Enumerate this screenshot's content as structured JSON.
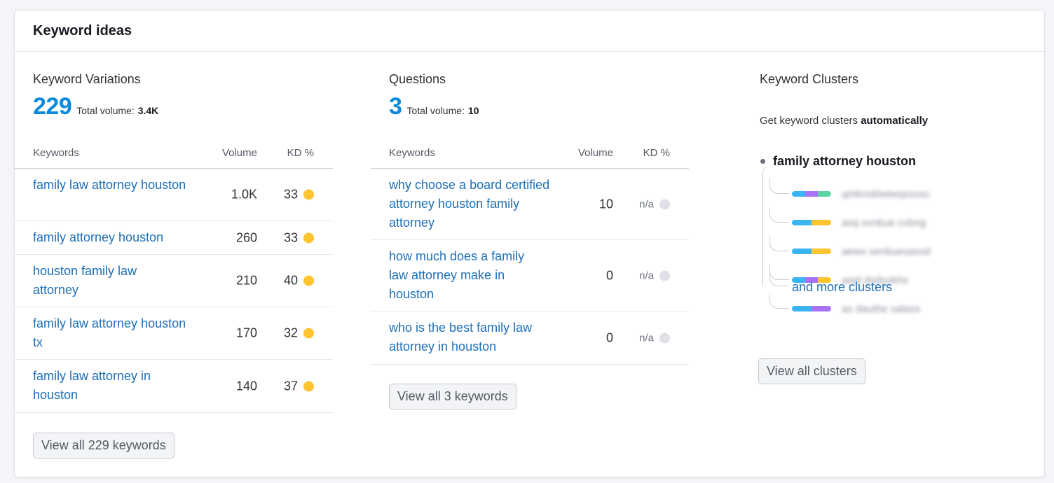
{
  "card": {
    "title": "Keyword ideas"
  },
  "variations": {
    "title": "Keyword Variations",
    "count": "229",
    "total_volume_label": "Total volume:",
    "total_volume": "3.4K",
    "headers": {
      "keyword": "Keywords",
      "volume": "Volume",
      "kd": "KD %"
    },
    "rows": [
      {
        "keyword": "family law attorney houston",
        "volume": "1.0K",
        "kd": "33",
        "kd_color": "#ffc531"
      },
      {
        "keyword": "family attorney houston",
        "volume": "260",
        "kd": "33",
        "kd_color": "#ffc531"
      },
      {
        "keyword": "houston family law attorney",
        "volume": "210",
        "kd": "40",
        "kd_color": "#ffc531"
      },
      {
        "keyword": "family law attorney houston tx",
        "volume": "170",
        "kd": "32",
        "kd_color": "#ffc531"
      },
      {
        "keyword": "family law attorney in houston",
        "volume": "140",
        "kd": "37",
        "kd_color": "#ffc531"
      }
    ],
    "button": "View all 229 keywords"
  },
  "questions": {
    "title": "Questions",
    "count": "3",
    "total_volume_label": "Total volume:",
    "total_volume": "10",
    "headers": {
      "keyword": "Keywords",
      "volume": "Volume",
      "kd": "KD %"
    },
    "rows": [
      {
        "keyword": "why choose a board certified attorney houston family attorney",
        "volume": "10",
        "kd": "n/a",
        "kd_color": "#dfe1e6"
      },
      {
        "keyword": "how much does a family law attorney make in houston",
        "volume": "0",
        "kd": "n/a",
        "kd_color": "#dfe1e6"
      },
      {
        "keyword": "who is the best family law attorney in houston",
        "volume": "0",
        "kd": "n/a",
        "kd_color": "#dfe1e6"
      }
    ],
    "button": "View all 3 keywords"
  },
  "clusters": {
    "title": "Keyword Clusters",
    "description_prefix": "Get keyword clusters",
    "description_bold": "automatically",
    "root": "family attorney houston",
    "items": [
      {
        "label": "qmknxklwiwqxsxxc",
        "segments": [
          "#3ab4f2",
          "#a972f6",
          "#5bd6a2"
        ]
      },
      {
        "label": "asq xsnkue cxbng",
        "segments": [
          "#3ab4f2",
          "#ffc531"
        ]
      },
      {
        "label": "aewx senkuesaxxd",
        "segments": [
          "#3ab4f2",
          "#ffc531"
        ]
      },
      {
        "label": "awd dsdsokhs",
        "segments": [
          "#3ab4f2",
          "#a972f6",
          "#ffc531"
        ]
      },
      {
        "label": "as dauthe salasx",
        "segments": [
          "#3ab4f2",
          "#a972f6"
        ]
      }
    ],
    "more_link": "and more clusters",
    "button": "View all clusters"
  },
  "colors": {
    "accent": "#0a8adc",
    "link": "#1d6fb8",
    "kd_easy_medium": "#ffc531",
    "kd_na": "#dfe1e6"
  }
}
